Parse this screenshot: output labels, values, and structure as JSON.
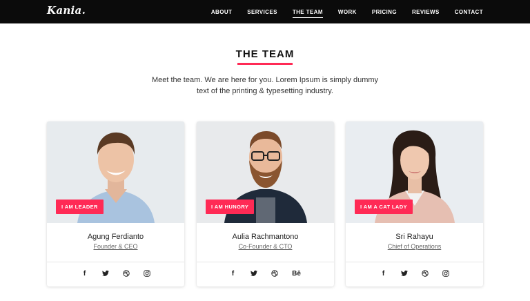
{
  "header": {
    "logo": "Kania.",
    "nav": [
      {
        "label": "ABOUT",
        "active": false
      },
      {
        "label": "SERVICES",
        "active": false
      },
      {
        "label": "THE TEAM",
        "active": true
      },
      {
        "label": "WORK",
        "active": false
      },
      {
        "label": "PRICING",
        "active": false
      },
      {
        "label": "REVIEWS",
        "active": false
      },
      {
        "label": "CONTACT",
        "active": false
      }
    ]
  },
  "section": {
    "title": "THE TEAM",
    "intro": "Meet the team. We are here for you. Lorem Ipsum is simply dummy text of the printing & typesetting industry."
  },
  "colors": {
    "accent": "#ff2a55",
    "nav_bg": "#0b0b0b"
  },
  "team": [
    {
      "badge": "I AM LEADER",
      "name": "Agung Ferdianto",
      "role": "Founder & CEO",
      "socials": [
        "facebook-icon",
        "twitter-icon",
        "dribbble-icon",
        "instagram-icon"
      ]
    },
    {
      "badge": "I AM HUNGRY",
      "name": "Aulia Rachmantono",
      "role": "Co-Founder & CTO",
      "socials": [
        "facebook-icon",
        "twitter-icon",
        "dribbble-icon",
        "behance-icon"
      ]
    },
    {
      "badge": "I AM A CAT LADY",
      "name": "Sri Rahayu",
      "role": "Chief of Operations",
      "socials": [
        "facebook-icon",
        "twitter-icon",
        "dribbble-icon",
        "instagram-icon"
      ]
    }
  ],
  "social_glyphs": {
    "facebook-icon": "f",
    "behance-icon": "Bē"
  }
}
